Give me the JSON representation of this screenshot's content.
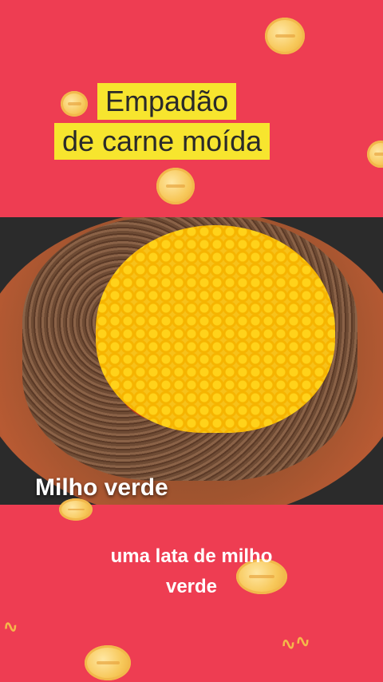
{
  "title": {
    "line1": "Empadão",
    "line2": "de carne moída"
  },
  "video": {
    "overlay_caption": "Milho verde"
  },
  "subtitle": {
    "line1": "uma lata de milho",
    "line2": "verde"
  },
  "colors": {
    "background": "#ee3d52",
    "title_highlight": "#f7e52e",
    "coin": "#f7c85a"
  },
  "decorations": {
    "coin_icon": "coin-icon",
    "squiggle_icon": "squiggle-icon"
  }
}
